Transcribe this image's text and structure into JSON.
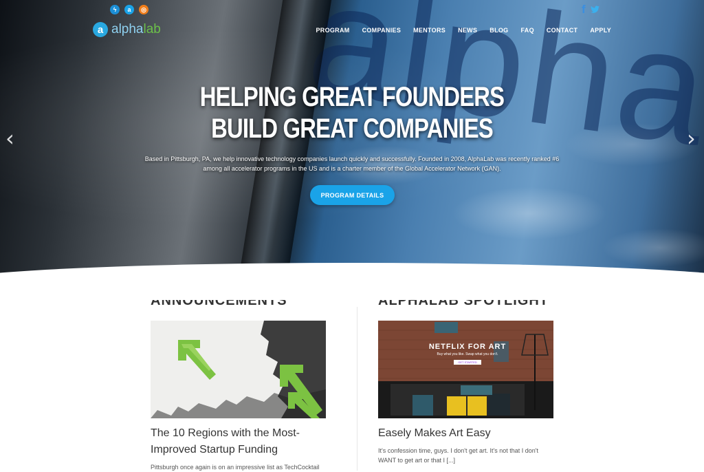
{
  "brand": {
    "logo_letter": "a",
    "name_part1": "alpha",
    "name_part2": "lab"
  },
  "social": {
    "top_icons": [
      {
        "name": "bolt-icon",
        "glyph": "ϟ",
        "color": "#1c8fd6"
      },
      {
        "name": "a-circle-icon",
        "glyph": "a",
        "color": "#1aa3e8"
      },
      {
        "name": "orange-ring-icon",
        "glyph": "◎",
        "color": "#f07d1a"
      }
    ],
    "facebook": "f",
    "twitter": "❧"
  },
  "nav": {
    "items": [
      "PROGRAM",
      "COMPANIES",
      "MENTORS",
      "NEWS",
      "BLOG",
      "FAQ",
      "CONTACT",
      "APPLY"
    ]
  },
  "hero": {
    "bg_letters": "alpha",
    "bg_letters_left": "alph",
    "title_line1": "HELPING GREAT FOUNDERS",
    "title_line2": "BUILD GREAT COMPANIES",
    "description": "Based in Pittsburgh, PA, we help innovative technology companies launch quickly and successfully. Founded in 2008, AlphaLab was recently ranked #6 among all accelerator programs in the US and is a charter member of the Global Accelerator Network (GAN).",
    "cta_label": "PROGRAM DETAILS",
    "prev_arrow": "‹",
    "next_arrow": "›"
  },
  "sections": {
    "announcements": {
      "heading": "ANNOUNCEMENTS",
      "post_title": "The 10 Regions with the Most-Improved Startup Funding",
      "excerpt": "Pittsburgh once again is on an impressive list as TechCocktail"
    },
    "spotlight": {
      "heading": "ALPHALAB SPOTLIGHT",
      "image_title": "NETFLIX FOR ART",
      "image_tagline": "Buy what you like. Swap what you don't.",
      "image_button": "GET STARTED",
      "post_title": "Easely Makes Art Easy",
      "excerpt": "It's confession time, guys. I don't get art. It's not that I don't WANT to get art or that I [...]"
    }
  },
  "colors": {
    "accent": "#1aa3e8",
    "logo_green": "#6cc04a",
    "arrow_green": "#7cc242"
  }
}
